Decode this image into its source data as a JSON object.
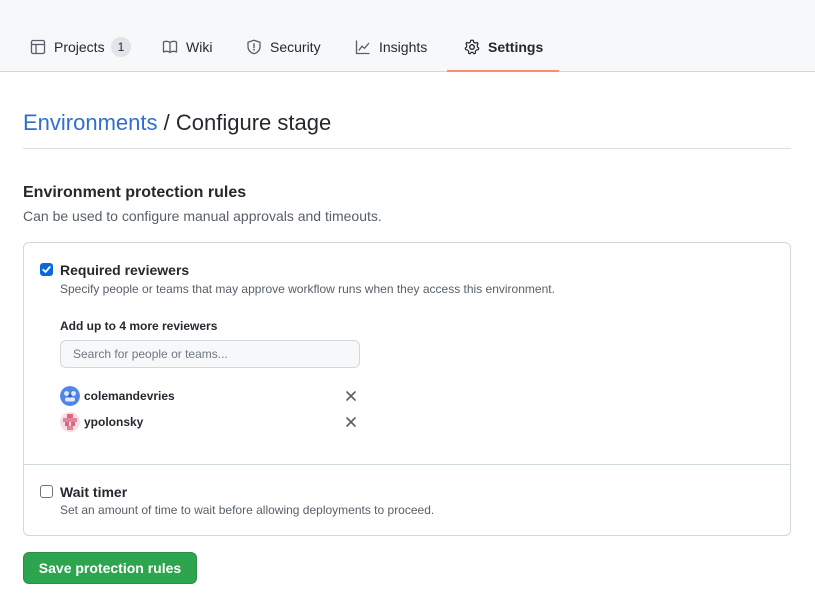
{
  "nav": {
    "tabs": [
      {
        "label": "Projects",
        "icon": "table-icon",
        "counter": "1"
      },
      {
        "label": "Wiki",
        "icon": "book-icon"
      },
      {
        "label": "Security",
        "icon": "shield-icon"
      },
      {
        "label": "Insights",
        "icon": "graph-icon"
      },
      {
        "label": "Settings",
        "icon": "gear-icon",
        "active": true
      }
    ]
  },
  "header": {
    "breadcrumb_link": "Environments",
    "separator": "/",
    "title": "Configure stage"
  },
  "protection": {
    "title": "Environment protection rules",
    "description": "Can be used to configure manual approvals and timeouts.",
    "required_reviewers": {
      "checked": true,
      "label": "Required reviewers",
      "description": "Specify people or teams that may approve workflow runs when they access this environment.",
      "add_label": "Add up to 4 more reviewers",
      "search_placeholder": "Search for people or teams...",
      "reviewers": [
        {
          "name": "colemandevries",
          "avatar": "blue-identicon"
        },
        {
          "name": "ypolonsky",
          "avatar": "pink-identicon"
        }
      ]
    },
    "wait_timer": {
      "checked": false,
      "label": "Wait timer",
      "description": "Set an amount of time to wait before allowing deployments to proceed."
    }
  },
  "actions": {
    "save_label": "Save protection rules"
  },
  "colors": {
    "link": "#2f6fd0",
    "active_tab_underline": "#fd8c73",
    "primary_button": "#2da44e",
    "checkbox_checked": "#0969da"
  }
}
